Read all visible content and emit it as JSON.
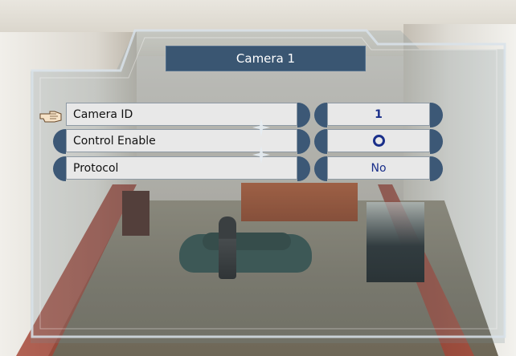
{
  "menu": {
    "title": "Camera 1",
    "items": [
      {
        "label": "Camera ID",
        "value": "1",
        "selected": true
      },
      {
        "label": "Control Enable",
        "value": "O",
        "value_type": "ring-icon"
      },
      {
        "label": "Protocol",
        "value": "No"
      }
    ]
  },
  "colors": {
    "title_bg": "#3a5672",
    "cell_bg": "#e8e8e8",
    "value_text": "#1a2f8a",
    "cap": "#3c5876",
    "frame_stroke": "#d8e2ea"
  },
  "icons": {
    "cursor": "pointing-hand-icon",
    "separator": "sparkle-icon"
  }
}
